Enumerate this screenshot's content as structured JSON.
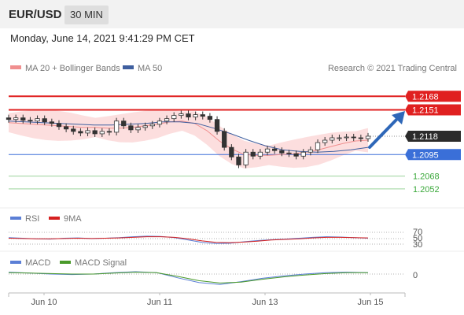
{
  "header": {
    "symbol": "EUR/USD",
    "timeframe": "30 MIN",
    "datetime": "Monday, June 14, 2021 9:41:29 PM CET"
  },
  "legend": {
    "ma20": "MA 20 + Bollinger Bands",
    "ma50": "MA 50",
    "credit": "Research © 2021 Trading Central",
    "rsi": "RSI",
    "rsi_ma": "9MA",
    "macd": "MACD",
    "macd_signal": "MACD Signal"
  },
  "colors": {
    "ma20": "#f08f8f",
    "ma50": "#3f5f9f",
    "resistance": "#e02020",
    "support": "#3a6fd8",
    "target": "#3aa83a",
    "price_tag": "#2b2b2b",
    "arrow": "#2e67b8",
    "rsi": "#5b7fd6",
    "rsi_ma": "#d62020",
    "macd": "#5b7fd6",
    "macd_signal": "#4a9a2a"
  },
  "chart_data": [
    {
      "type": "candlestick",
      "pane": "price",
      "x_labels": [
        "Jun 10",
        "Jun 11",
        "Jun 13",
        "Jun 15"
      ],
      "ylim": [
        1.204,
        1.219
      ],
      "close_series": [
        1.2139,
        1.2141,
        1.2138,
        1.2137,
        1.214,
        1.2136,
        1.2134,
        1.213,
        1.2127,
        1.2124,
        1.2122,
        1.2125,
        1.2121,
        1.2124,
        1.2123,
        1.2137,
        1.2131,
        1.2126,
        1.2129,
        1.2131,
        1.2133,
        1.2137,
        1.214,
        1.2144,
        1.2146,
        1.2142,
        1.2145,
        1.2143,
        1.2139,
        1.2124,
        1.2104,
        1.2092,
        1.2082,
        1.2098,
        1.2093,
        1.2098,
        1.2102,
        1.21,
        1.2097,
        1.2096,
        1.2093,
        1.2098,
        1.2101,
        1.211,
        1.2113,
        1.2116,
        1.2116,
        1.2117,
        1.2116,
        1.2115,
        1.2118
      ],
      "ma20_approx": [
        1.2135,
        1.2134,
        1.2133,
        1.2132,
        1.2131,
        1.213,
        1.2129,
        1.2129,
        1.2128,
        1.2128,
        1.2129,
        1.2131,
        1.2133,
        1.2136,
        1.2137,
        1.2134,
        1.2125,
        1.2112,
        1.2102,
        1.2095,
        1.2094,
        1.2094,
        1.2095,
        1.2096,
        1.2098,
        1.2101,
        1.2105,
        1.2109,
        1.2112,
        1.2113
      ],
      "ma50_approx": [
        1.2137,
        1.2136,
        1.2135,
        1.2134,
        1.2133,
        1.2132,
        1.2132,
        1.2133,
        1.2134,
        1.2136,
        1.2136,
        1.2134,
        1.2128,
        1.2121,
        1.2113,
        1.2106,
        1.2101,
        1.2099,
        1.2098,
        1.2099,
        1.2101,
        1.2104
      ],
      "levels": [
        {
          "label": "1.2168",
          "value": 1.2168,
          "kind": "resistance"
        },
        {
          "label": "1.2151",
          "value": 1.2151,
          "kind": "resistance"
        },
        {
          "label": "1.2118",
          "value": 1.2118,
          "kind": "last"
        },
        {
          "label": "1.2095",
          "value": 1.2095,
          "kind": "support"
        },
        {
          "label": "1.2068",
          "value": 1.2068,
          "kind": "target"
        },
        {
          "label": "1.2052",
          "value": 1.2052,
          "kind": "target"
        }
      ]
    },
    {
      "type": "line",
      "pane": "rsi",
      "levels": [
        "70",
        "50",
        "30"
      ],
      "series": [
        {
          "name": "RSI",
          "values": [
            52,
            50,
            48,
            47,
            50,
            51,
            49,
            50,
            52,
            55,
            57,
            56,
            52,
            44,
            36,
            32,
            33,
            38,
            42,
            45,
            47,
            50,
            53,
            55,
            54,
            52,
            50
          ]
        },
        {
          "name": "9MA",
          "values": [
            50,
            49,
            48,
            48,
            49,
            50,
            49,
            50,
            51,
            53,
            55,
            55,
            53,
            48,
            41,
            36,
            35,
            37,
            40,
            44,
            46,
            48,
            51,
            53,
            53,
            52,
            51
          ]
        }
      ]
    },
    {
      "type": "line",
      "pane": "macd",
      "levels": [
        "0"
      ],
      "series": [
        {
          "name": "MACD",
          "values": [
            0.0004,
            0.0002,
            0.0,
            -0.0001,
            0.0,
            0.0003,
            0.0005,
            0.0003,
            -0.0008,
            -0.0018,
            -0.0022,
            -0.0016,
            -0.0009,
            -0.0004,
            0.0,
            0.0003,
            0.0004,
            0.0003
          ]
        },
        {
          "name": "MACD Signal",
          "values": [
            0.0003,
            0.0002,
            0.0001,
            0.0,
            0.0,
            0.0002,
            0.0004,
            0.0003,
            -0.0005,
            -0.0014,
            -0.0019,
            -0.0017,
            -0.0011,
            -0.0006,
            -0.0002,
            0.0001,
            0.0003,
            0.0003
          ]
        }
      ]
    }
  ]
}
